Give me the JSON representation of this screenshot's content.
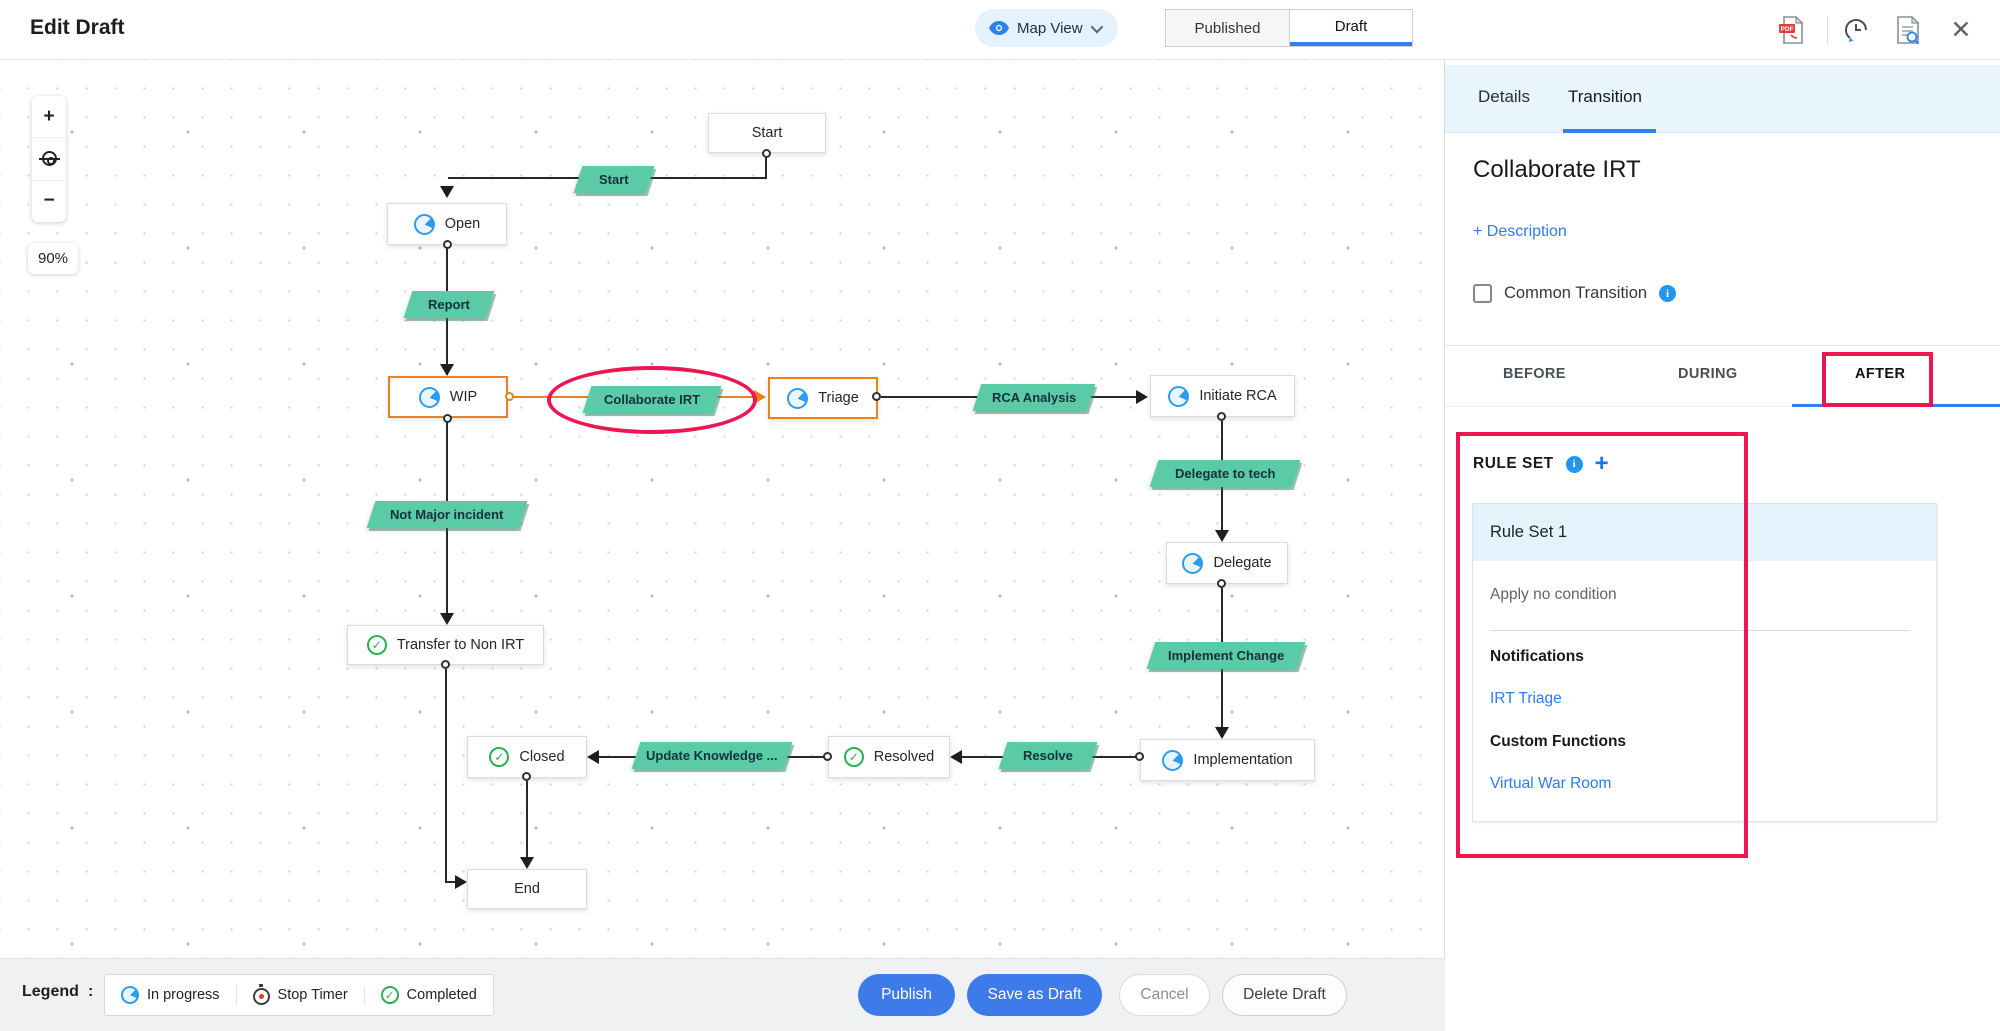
{
  "header": {
    "title": "Edit Draft",
    "map_view_label": "Map View",
    "published_label": "Published",
    "draft_label": "Draft"
  },
  "canvas": {
    "zoom_in": "+",
    "zoom_out": "−",
    "zoom_level": "90%",
    "nodes": [
      {
        "label": "Start",
        "icon": "none"
      },
      {
        "label": "Open",
        "icon": "in-progress"
      },
      {
        "label": "WIP",
        "icon": "in-progress",
        "selected": true
      },
      {
        "label": "Triage",
        "icon": "in-progress",
        "selected": true
      },
      {
        "label": "Initiate RCA",
        "icon": "in-progress"
      },
      {
        "label": "Delegate",
        "icon": "in-progress"
      },
      {
        "label": "Implementation",
        "icon": "in-progress"
      },
      {
        "label": "Resolved",
        "icon": "completed"
      },
      {
        "label": "Closed",
        "icon": "completed"
      },
      {
        "label": "Transfer to Non IRT",
        "icon": "completed"
      },
      {
        "label": "End",
        "icon": "none"
      }
    ],
    "transitions": [
      {
        "label": "Start"
      },
      {
        "label": "Report"
      },
      {
        "label": "Collaborate IRT",
        "annotated": true
      },
      {
        "label": "RCA Analysis"
      },
      {
        "label": "Delegate to tech"
      },
      {
        "label": "Not Major incident"
      },
      {
        "label": "Implement Change"
      },
      {
        "label": "Resolve"
      },
      {
        "label": "Update Knowledge ..."
      }
    ]
  },
  "legend": {
    "title": "Legend",
    "colon": ":",
    "items": [
      {
        "label": "In progress",
        "icon": "in-progress"
      },
      {
        "label": "Stop Timer",
        "icon": "stop-timer"
      },
      {
        "label": "Completed",
        "icon": "completed"
      }
    ]
  },
  "actions": {
    "publish": "Publish",
    "save_as_draft": "Save as Draft",
    "cancel": "Cancel",
    "delete_draft": "Delete Draft"
  },
  "panel": {
    "tabs": [
      "Details",
      "Transition"
    ],
    "active_tab": "Transition",
    "transition_name": "Collaborate IRT",
    "add_description_label": "+ Description",
    "common_transition_label": "Common Transition",
    "stage_tabs": [
      "BEFORE",
      "DURING",
      "AFTER"
    ],
    "active_stage_tab": "AFTER",
    "rule_set": {
      "title": "RULE SET",
      "rule_name": "Rule Set 1",
      "condition": "Apply no condition",
      "notifications_label": "Notifications",
      "notification_link": "IRT Triage",
      "custom_functions_label": "Custom Functions",
      "custom_function_link": "Virtual War Room"
    }
  },
  "colors": {
    "accent_blue": "#2f80ed",
    "transition_green": "#5bcaa6",
    "selected_orange": "#e8821e",
    "annotation_red": "#ee1650",
    "link_blue": "#2e7cf0",
    "panel_band_blue": "#e9f5fc"
  }
}
